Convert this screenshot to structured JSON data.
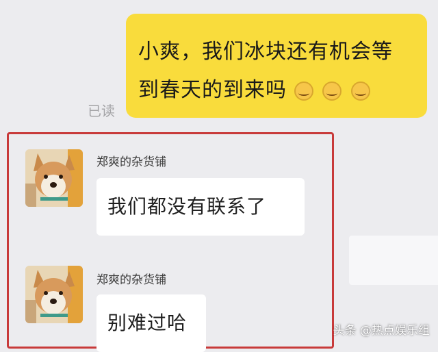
{
  "messages": {
    "outgoing": {
      "line1": "小爽，我们冰块还有机会等",
      "line2": "到春天的到来吗",
      "emoji_count": 3,
      "emoji_name": "crying-laugh-face",
      "read_status": "已读",
      "bubble_color": "#f9dc3c"
    },
    "incoming": [
      {
        "sender": "郑爽的杂货铺",
        "text": "我们都没有联系了"
      },
      {
        "sender": "郑爽的杂货铺",
        "text": "别难过哈"
      }
    ]
  },
  "highlight_color": "#c83a3a",
  "avatar_icon": "shiba-dog-avatar",
  "watermark": {
    "source": "头条",
    "handle": "@热点娱乐组"
  }
}
